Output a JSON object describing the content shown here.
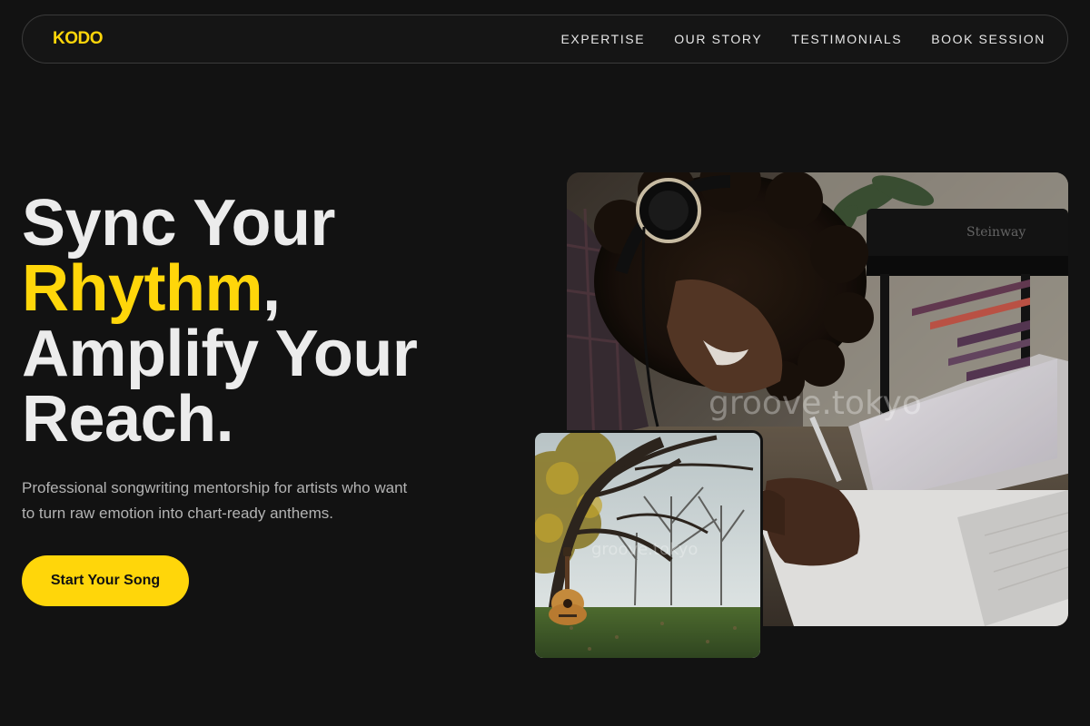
{
  "brand": {
    "logo": "KODO",
    "accent_color": "#ffd60a"
  },
  "nav": {
    "links": [
      {
        "label": "EXPERTISE"
      },
      {
        "label": "OUR STORY"
      },
      {
        "label": "TESTIMONIALS"
      },
      {
        "label": "BOOK SESSION"
      }
    ]
  },
  "hero": {
    "title_line1": "Sync Your",
    "title_accent": "Rhythm",
    "title_comma": ",",
    "title_line3": "Amplify Your",
    "title_line4": "Reach.",
    "subtitle": "Professional songwriting mentorship for artists who want to turn raw emotion into chart-ready anthems.",
    "cta_label": "Start Your Song"
  },
  "images": {
    "main_watermark": "groove.tokyo",
    "small_watermark": "groove.tokyo",
    "main_icon": "musician-with-headphones-photo",
    "small_icon": "guitar-under-tree-photo"
  }
}
